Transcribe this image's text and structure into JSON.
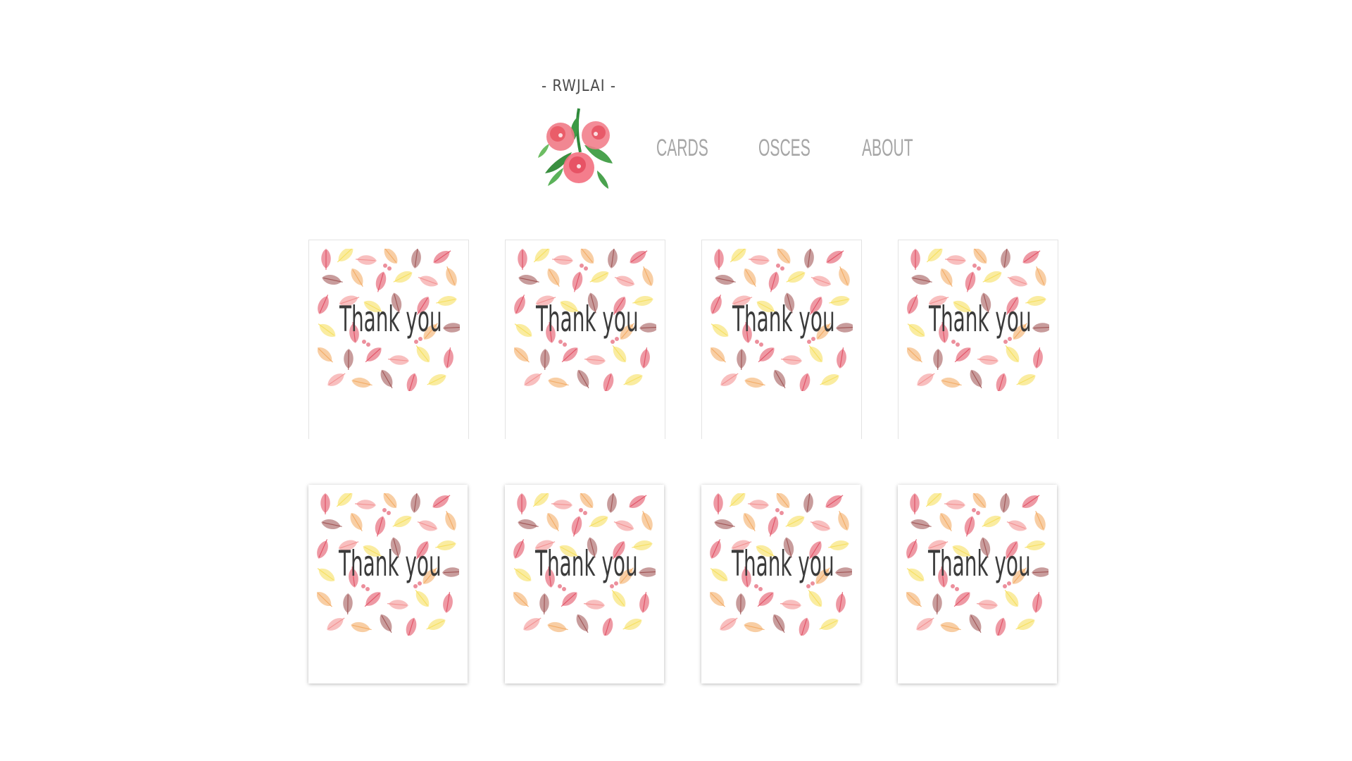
{
  "brand": {
    "name": "- RWJLAI -",
    "logo_icon": "watercolor-flower-bouquet-icon"
  },
  "nav": {
    "items": [
      {
        "label": "Cards"
      },
      {
        "label": "OSCES"
      },
      {
        "label": "About"
      }
    ]
  },
  "cards": [
    {
      "caption": "Thank you",
      "image": "autumn-leaves-pattern"
    },
    {
      "caption": "Thank you",
      "image": "autumn-leaves-pattern"
    },
    {
      "caption": "Thank you",
      "image": "autumn-leaves-pattern"
    },
    {
      "caption": "Thank you",
      "image": "autumn-leaves-pattern"
    },
    {
      "caption": "Thank you",
      "image": "autumn-leaves-pattern"
    },
    {
      "caption": "Thank you",
      "image": "autumn-leaves-pattern"
    },
    {
      "caption": "Thank you",
      "image": "autumn-leaves-pattern"
    },
    {
      "caption": "Thank you",
      "image": "autumn-leaves-pattern"
    }
  ],
  "colors": {
    "nav_text": "#a6a6a6",
    "caption_text": "#3b3b3b",
    "leaf_red": "#e0455a",
    "leaf_orange": "#f2a55a",
    "leaf_yellow": "#f6dd52",
    "leaf_brown": "#9b4a4a",
    "leaf_pink": "#f28a8a"
  }
}
